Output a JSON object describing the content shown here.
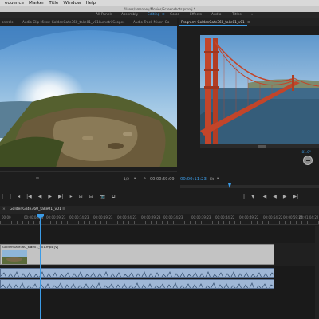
{
  "menubar": {
    "items": [
      "equence",
      "Marker",
      "Title",
      "Window",
      "Help"
    ]
  },
  "pathbar": {
    "text": "/Users/amsoney/Movies/Screenshots.prproj *"
  },
  "workspaces": {
    "items": [
      "All Panels",
      "Assembly",
      "Editing",
      "Color",
      "Effects",
      "Audio",
      "Titles"
    ],
    "active": "Editing",
    "more": "»"
  },
  "source_tabs": [
    "ontrols",
    "Audio Clip Mixer: GoldenGate360_take01_v01",
    "Lumetri Scopes",
    "Audio Track Mixer: Go"
  ],
  "program": {
    "tab_label": "Program: GoldenGate360_take01_v01",
    "menu_icon": "≡",
    "timecode": "00:00:11:23",
    "fit_label": "Fit",
    "vr_angle": "-81.0°"
  },
  "source": {
    "timecode": "00:00:59:09",
    "zoom": "1/2",
    "settings_icon": "wrench-icon"
  },
  "transport": {
    "left": [
      "|",
      "|",
      "◂",
      "|◀",
      "◀",
      "▶",
      "▶|",
      "▸",
      "⊞",
      "⊟",
      "📷",
      "⧉"
    ],
    "right": [
      "|",
      "▼",
      "|◀",
      "◀",
      "▶",
      "▶|"
    ]
  },
  "timeline": {
    "tab_label": "GoldenGate360_take01_v01",
    "close_icon": "×",
    "ruler_ticks": [
      "00:00",
      "00:00:04:23",
      "00:00:09:23",
      "00:00:14:23",
      "00:00:19:23",
      "00:00:24:23",
      "00:00:29:23",
      "00:00:34:23",
      "00:00:39:23",
      "00:00:44:22",
      "00:00:49:22",
      "00:00:54:22",
      "00:00:59:22",
      "00:01:04:22"
    ],
    "clip_label": "GoldenGate360_take01_v01.mp4 [V]",
    "fx_badge": "fx"
  },
  "colors": {
    "accent": "#3b9be6",
    "bridge": "#c2452a",
    "sky": "#6ea6d6"
  }
}
